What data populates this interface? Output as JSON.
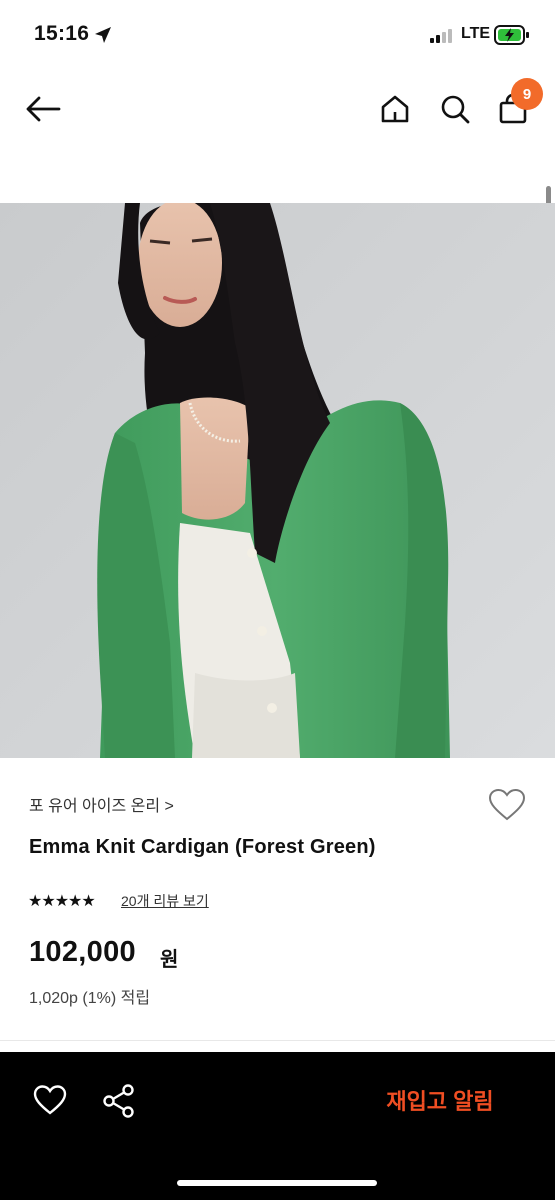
{
  "status_bar": {
    "time": "15:16",
    "network": "LTE",
    "icons": [
      "location-arrow-icon",
      "signal-icon",
      "battery-charging-icon"
    ]
  },
  "nav": {
    "icons": [
      "back-arrow-icon",
      "home-icon",
      "search-icon",
      "shopping-bag-icon"
    ],
    "cart_count": "9",
    "badge_color": "#f26b2a"
  },
  "product": {
    "brand": "포 유어 아이즈 온리 >",
    "title": "Emma Knit Cardigan (Forest Green)",
    "stars": "★★★★★",
    "rating": 5,
    "review_link": "20개 리뷰 보기",
    "price": "102,000",
    "price_unit": "원",
    "points": "1,020p (1%) 적립",
    "image_icon": "product-photo-green-cardigan",
    "cardigan_color": "#4ea86a"
  },
  "bottom_bar": {
    "icons": [
      "heart-outline-icon",
      "share-icon"
    ],
    "restock_label": "재입고 알림",
    "accent_color": "#f04e23"
  }
}
